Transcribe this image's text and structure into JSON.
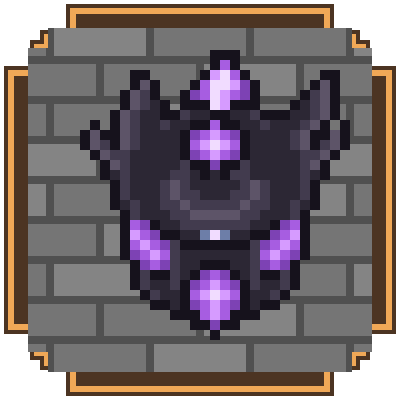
{
  "item_slot": {
    "item_icon": "dark-spiked-armor-icon",
    "frame_icon": "ornate-copper-frame",
    "background_icon": "stone-brick-wall"
  },
  "colors": {
    "frame_light": "#f0a857",
    "frame_dark": "#4c3422",
    "stone": "#757575",
    "stone_light": "#848484",
    "mortar": "#505050",
    "outline": "#16121c",
    "armor_dark": "#2c2734",
    "armor_mid": "#423b4e",
    "armor_light": "#5d5468",
    "gem_dark": "#7d42b4",
    "gem_mid": "#a75de1",
    "gem_light": "#d69bff",
    "gem_glint": "#f1dcff",
    "accent_blue": "#6d7ea8"
  }
}
